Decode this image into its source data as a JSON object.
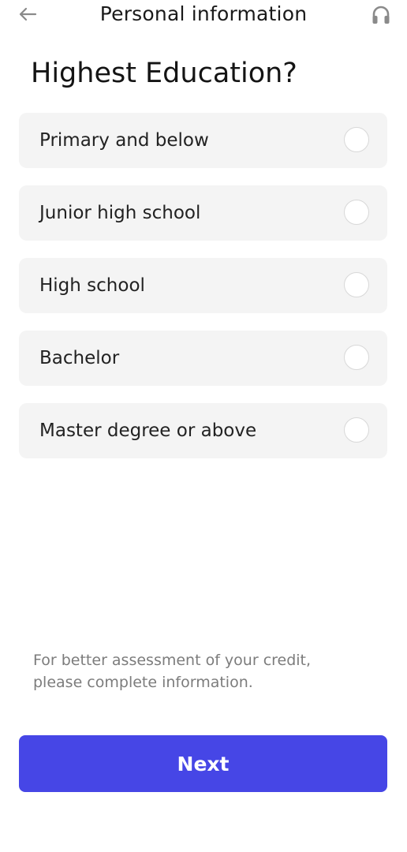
{
  "header": {
    "back_icon": "arrow-left-icon",
    "title": "Personal information",
    "support_icon": "headset-icon"
  },
  "question": "Highest Education?",
  "options": [
    {
      "label": "Primary and below",
      "selected": false
    },
    {
      "label": "Junior high school",
      "selected": false
    },
    {
      "label": "High school",
      "selected": false
    },
    {
      "label": "Bachelor",
      "selected": false
    },
    {
      "label": "Master degree or above",
      "selected": false
    }
  ],
  "note": "For better assessment of your credit, please complete information.",
  "next_label": "Next",
  "colors": {
    "accent": "#4646e6",
    "option_bg": "#f4f4f4",
    "note_text": "#7c7c7c"
  }
}
